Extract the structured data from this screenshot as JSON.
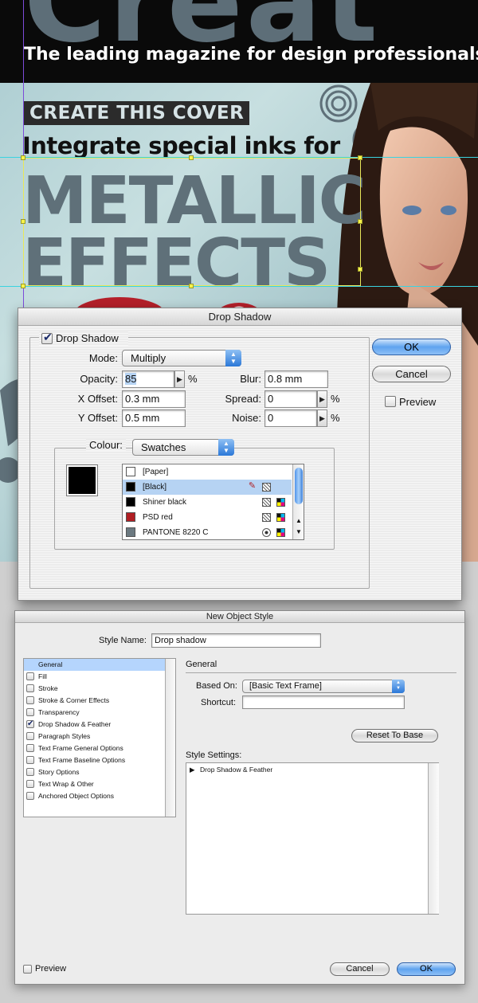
{
  "colors": {
    "accent_blue": "#5fa3ef",
    "selection_blue": "#b6d3f3",
    "cover_teal": "#a9cbd0",
    "cover_big_text": "#5f7079",
    "psd_red": "#b01e23",
    "pantone_grey": "#6b7980"
  },
  "cover": {
    "tagline": "The leading magazine for design professionals",
    "badge": "CREATE THIS COVER",
    "subhead": "Integrate special inks for",
    "big_line1": "METALLIC",
    "big_line2": "EFFECTS"
  },
  "drop_shadow_dialog": {
    "title": "Drop Shadow",
    "section_label": "Drop Shadow",
    "section_checked": true,
    "mode_label": "Mode:",
    "mode_value": "Multiply",
    "opacity_label": "Opacity:",
    "opacity_value": "85",
    "opacity_unit": "%",
    "x_offset_label": "X Offset:",
    "x_offset_value": "0.3 mm",
    "y_offset_label": "Y Offset:",
    "y_offset_value": "0.5 mm",
    "blur_label": "Blur:",
    "blur_value": "0.8 mm",
    "spread_label": "Spread:",
    "spread_value": "0",
    "spread_unit": "%",
    "noise_label": "Noise:",
    "noise_value": "0",
    "noise_unit": "%",
    "colour_label": "Colour:",
    "colour_value": "Swatches",
    "swatches": [
      {
        "name": "[Paper]",
        "chip": "#ffffff",
        "selected": false
      },
      {
        "name": "[Black]",
        "chip": "#000000",
        "selected": true
      },
      {
        "name": "Shiner black",
        "chip": "#000000",
        "selected": false
      },
      {
        "name": "PSD red",
        "chip": "#b01e23",
        "selected": false
      },
      {
        "name": "PANTONE 8220 C",
        "chip": "#6b7980",
        "selected": false
      }
    ],
    "ok_label": "OK",
    "cancel_label": "Cancel",
    "preview_label": "Preview",
    "preview_checked": false
  },
  "new_object_style_dialog": {
    "title": "New Object Style",
    "style_name_label": "Style Name:",
    "style_name_value": "Drop shadow",
    "categories": [
      {
        "label": "General",
        "has_checkbox": false,
        "checked": false,
        "selected": true
      },
      {
        "label": "Fill",
        "has_checkbox": true,
        "checked": false,
        "selected": false
      },
      {
        "label": "Stroke",
        "has_checkbox": true,
        "checked": false,
        "selected": false
      },
      {
        "label": "Stroke & Corner Effects",
        "has_checkbox": true,
        "checked": false,
        "selected": false
      },
      {
        "label": "Transparency",
        "has_checkbox": true,
        "checked": false,
        "selected": false
      },
      {
        "label": "Drop Shadow & Feather",
        "has_checkbox": true,
        "checked": true,
        "selected": false
      },
      {
        "label": "Paragraph Styles",
        "has_checkbox": true,
        "checked": false,
        "selected": false
      },
      {
        "label": "Text Frame General Options",
        "has_checkbox": true,
        "checked": false,
        "selected": false
      },
      {
        "label": "Text Frame Baseline Options",
        "has_checkbox": true,
        "checked": false,
        "selected": false
      },
      {
        "label": "Story Options",
        "has_checkbox": true,
        "checked": false,
        "selected": false
      },
      {
        "label": "Text Wrap & Other",
        "has_checkbox": true,
        "checked": false,
        "selected": false
      },
      {
        "label": "Anchored Object Options",
        "has_checkbox": true,
        "checked": false,
        "selected": false
      }
    ],
    "section_title": "General",
    "based_on_label": "Based On:",
    "based_on_value": "[Basic Text Frame]",
    "shortcut_label": "Shortcut:",
    "shortcut_value": "",
    "reset_label": "Reset To Base",
    "style_settings_label": "Style Settings:",
    "style_settings_item": "Drop Shadow & Feather",
    "preview_label": "Preview",
    "preview_checked": false,
    "cancel_label": "Cancel",
    "ok_label": "OK"
  }
}
